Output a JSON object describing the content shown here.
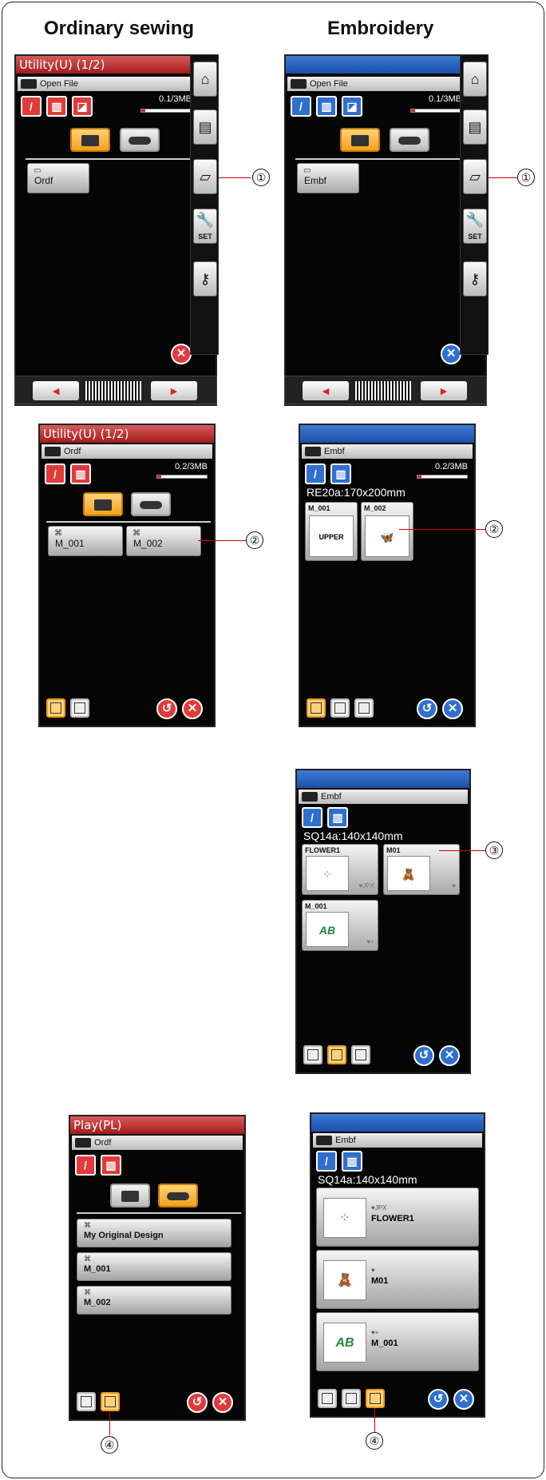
{
  "headers": {
    "left": "Ordinary sewing",
    "right": "Embroidery"
  },
  "callouts": {
    "c1": "①",
    "c2": "②",
    "c3": "③",
    "c4": "④"
  },
  "screen1": {
    "title": "Utility(U) (1/2)",
    "path": "Open File",
    "mem": "0.1/3MB",
    "folder": "Ordf"
  },
  "screen2": {
    "title": "",
    "path": "Open File",
    "mem": "0.1/3MB",
    "folder": "Embf"
  },
  "screen3": {
    "title": "Utility(U) (1/2)",
    "path": "Ordf",
    "mem": "0.2/3MB",
    "files": [
      "M_001",
      "M_002"
    ]
  },
  "screen4": {
    "title": "",
    "path": "Embf",
    "mem": "0.2/3MB",
    "hoop": "RE20a:170x200mm",
    "files": [
      "M_001",
      "M_002"
    ],
    "art": [
      "UPPER",
      "🦋"
    ]
  },
  "screen5": {
    "path": "Embf",
    "hoop": "SQ14a:140x140mm",
    "files": [
      {
        "name": "FLOWER1",
        "sub": "♥JPX"
      },
      {
        "name": "M01",
        "sub": "♥"
      },
      {
        "name": "M_001",
        "sub": "♥+"
      }
    ]
  },
  "screen6": {
    "title": "Play(PL)",
    "path": "Ordf",
    "files": [
      "My Original Design",
      "M_001",
      "M_002"
    ]
  },
  "screen7": {
    "path": "Embf",
    "hoop": "SQ14a:140x140mm",
    "files": [
      {
        "name": "FLOWER1",
        "sub": "♥JPX"
      },
      {
        "name": "M01",
        "sub": "♥"
      },
      {
        "name": "M_001",
        "sub": "♥+"
      }
    ]
  },
  "sidebar": {
    "set_label": "SET"
  },
  "icons": {
    "stitch": "✎",
    "delete": "🗑",
    "close": "✕",
    "back": "↺",
    "left": "◄",
    "right": "►"
  }
}
